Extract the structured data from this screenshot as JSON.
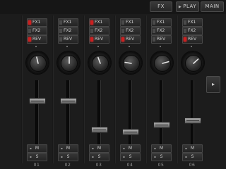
{
  "top_bar": {
    "fx_label": "FX",
    "play_label": "PLAY",
    "main_label": "MAIN",
    "play_icon": "play-triangle-icon"
  },
  "channels": [
    {
      "number": "01",
      "sends": [
        {
          "label": "FX1",
          "on": true
        },
        {
          "label": "FX2",
          "on": false
        },
        {
          "label": "REV",
          "on": true
        }
      ],
      "mute": "M",
      "solo": "S",
      "fader_level": 0.72,
      "pan": -0.1
    },
    {
      "number": "02",
      "sends": [
        {
          "label": "FX1",
          "on": false
        },
        {
          "label": "FX2",
          "on": false
        },
        {
          "label": "REV",
          "on": false
        }
      ],
      "mute": "M",
      "solo": "S",
      "fader_level": 0.72,
      "pan": 0.0
    },
    {
      "number": "03",
      "sends": [
        {
          "label": "FX1",
          "on": true
        },
        {
          "label": "FX2",
          "on": false
        },
        {
          "label": "REV",
          "on": true
        }
      ],
      "mute": "M",
      "solo": "S",
      "fader_level": 0.25,
      "pan": -0.15
    },
    {
      "number": "04",
      "sends": [
        {
          "label": "FX1",
          "on": false
        },
        {
          "label": "FX2",
          "on": false
        },
        {
          "label": "REV",
          "on": true
        }
      ],
      "mute": "M",
      "solo": "S",
      "fader_level": 0.22,
      "pan": -0.6
    },
    {
      "number": "05",
      "sends": [
        {
          "label": "FX1",
          "on": false
        },
        {
          "label": "FX2",
          "on": false
        },
        {
          "label": "REV",
          "on": false
        }
      ],
      "mute": "M",
      "solo": "S",
      "fader_level": 0.33,
      "pan": 0.55
    },
    {
      "number": "06",
      "sends": [
        {
          "label": "FX1",
          "on": false
        },
        {
          "label": "FX2",
          "on": false
        },
        {
          "label": "REV",
          "on": true
        }
      ],
      "mute": "M",
      "solo": "S",
      "fader_level": 0.4,
      "pan": 0.35
    }
  ],
  "page_arrow_icon": "chevron-right-icon",
  "page_arrow_label": "▸"
}
